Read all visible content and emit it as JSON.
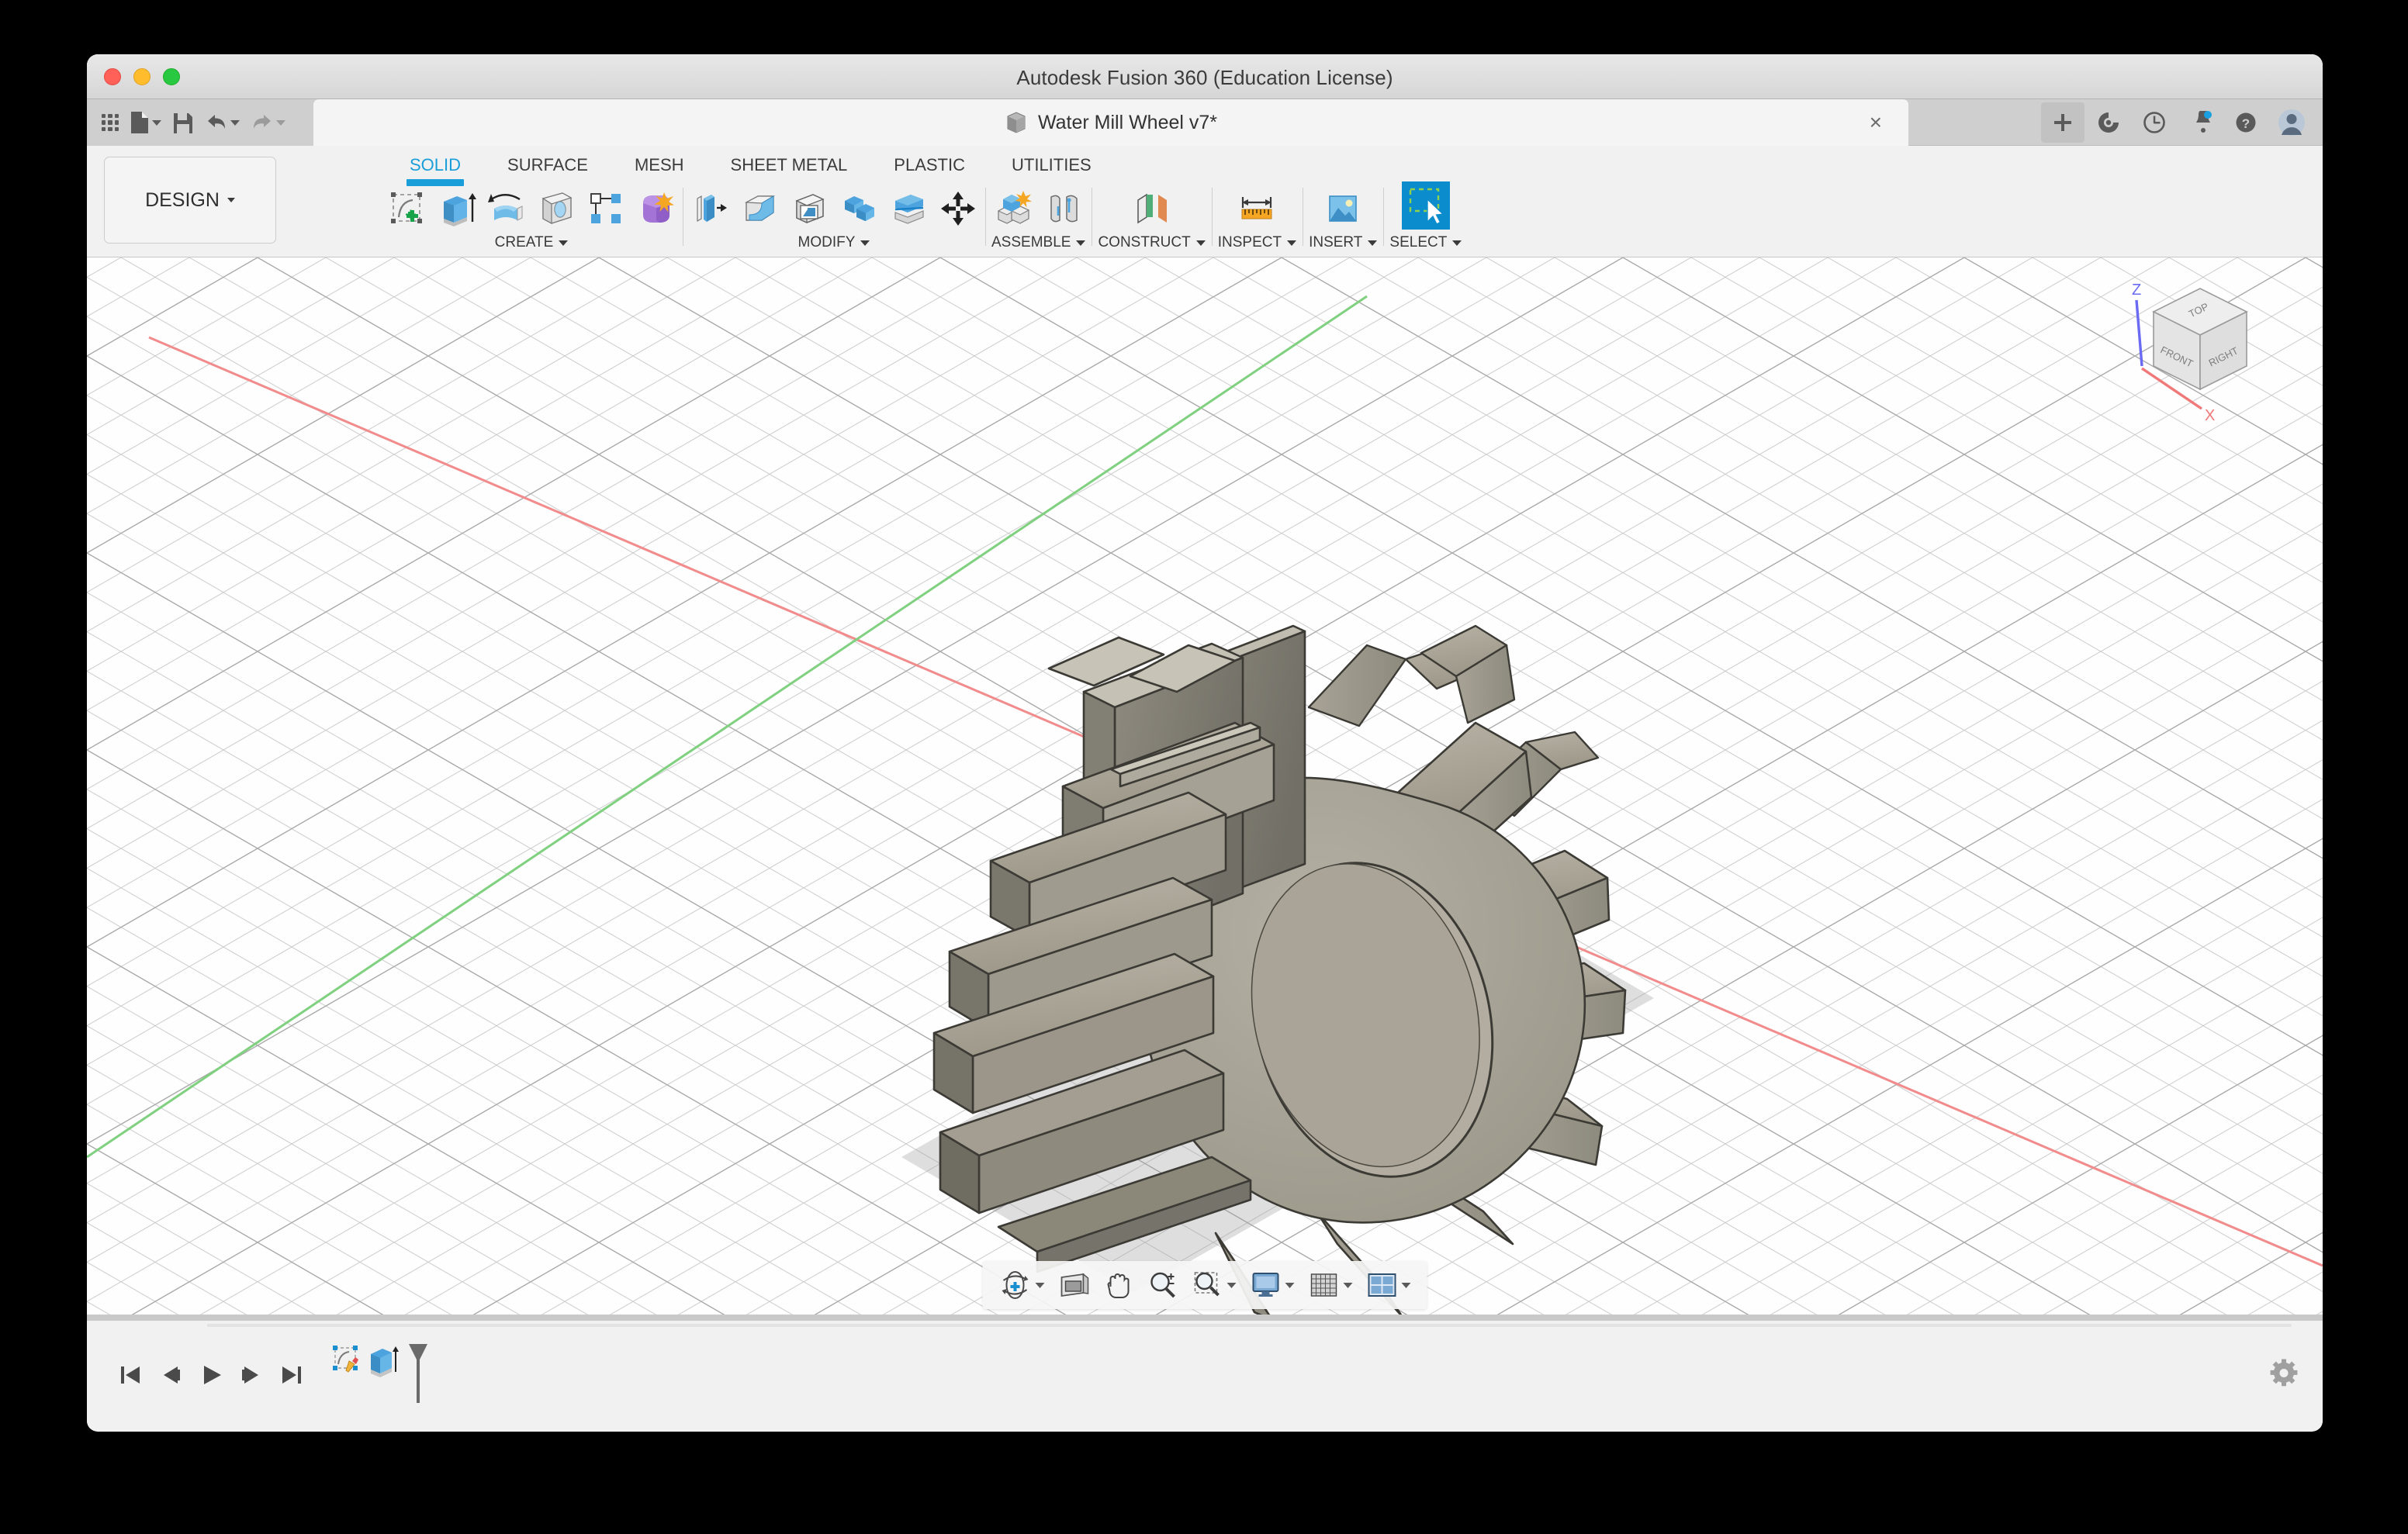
{
  "window": {
    "app_title": "Autodesk Fusion 360 (Education License)",
    "traffic_lights": [
      "close",
      "minimize",
      "maximize"
    ]
  },
  "quick_access": {
    "items": [
      {
        "name": "app-grid-icon",
        "label": "Show Data Panel"
      },
      {
        "name": "new-file-icon",
        "label": "File"
      },
      {
        "name": "save-icon",
        "label": "Save"
      },
      {
        "name": "undo-icon",
        "label": "Undo"
      },
      {
        "name": "redo-icon",
        "label": "Redo"
      }
    ]
  },
  "document_tab": {
    "title": "Water Mill Wheel v7*",
    "close_label": "×",
    "new_tab_label": "+"
  },
  "tab_right_icons": [
    {
      "name": "extensions-icon",
      "label": "Extensions"
    },
    {
      "name": "job-status-clock-icon",
      "label": "Job Status"
    },
    {
      "name": "notifications-bell-icon",
      "label": "Notifications",
      "badge": true
    },
    {
      "name": "help-icon",
      "label": "Help"
    },
    {
      "name": "account-avatar",
      "label": "Account"
    }
  ],
  "ribbon": {
    "design_label": "DESIGN",
    "tabs": [
      {
        "label": "SOLID",
        "active": true
      },
      {
        "label": "SURFACE",
        "active": false
      },
      {
        "label": "MESH",
        "active": false
      },
      {
        "label": "SHEET METAL",
        "active": false
      },
      {
        "label": "PLASTIC",
        "active": false
      },
      {
        "label": "UTILITIES",
        "active": false
      }
    ],
    "panels": [
      {
        "label": "CREATE",
        "tools": [
          "create-sketch-icon",
          "extrude-icon",
          "revolve-icon",
          "hole-icon",
          "pattern-icon",
          "form-icon"
        ]
      },
      {
        "label": "MODIFY",
        "tools": [
          "press-pull-icon",
          "fillet-icon",
          "shell-icon",
          "combine-icon",
          "split-face-icon",
          "move-copy-icon"
        ]
      },
      {
        "label": "ASSEMBLE",
        "tools": [
          "new-component-icon",
          "joint-icon"
        ]
      },
      {
        "label": "CONSTRUCT",
        "tools": [
          "offset-plane-icon"
        ]
      },
      {
        "label": "INSPECT",
        "tools": [
          "measure-icon"
        ]
      },
      {
        "label": "INSERT",
        "tools": [
          "insert-canvas-icon"
        ]
      },
      {
        "label": "SELECT",
        "tools": [
          "select-window-icon"
        ]
      }
    ]
  },
  "viewcube": {
    "faces": {
      "top": "TOP",
      "front": "FRONT",
      "right": "RIGHT"
    },
    "axes": {
      "z": "Z",
      "x": "X"
    },
    "colors": {
      "z_axis": "#5a5af0",
      "x_axis": "#f06060"
    }
  },
  "canvas": {
    "background": "#fefefe",
    "grid_color": "#cfcfcf",
    "x_axis_color": "#f28b8b",
    "y_axis_color": "#7fd07f",
    "model_name": "water-mill-wheel",
    "model_fill": "#9a968b",
    "ground_shadow": "#d6d6d6"
  },
  "navbar": {
    "items": [
      {
        "name": "orbit-icon",
        "label": "Orbit",
        "has_caret": true
      },
      {
        "name": "look-at-icon",
        "label": "Look At",
        "has_caret": false
      },
      {
        "name": "pan-icon",
        "label": "Pan",
        "has_caret": false
      },
      {
        "name": "zoom-icon",
        "label": "Zoom",
        "has_caret": false
      },
      {
        "name": "fit-icon",
        "label": "Fit",
        "has_caret": true
      },
      {
        "name": "display-settings-icon",
        "label": "Display Settings",
        "has_caret": true
      },
      {
        "name": "grid-snaps-icon",
        "label": "Grid and Snaps",
        "has_caret": true
      },
      {
        "name": "viewports-icon",
        "label": "Viewports",
        "has_caret": true
      }
    ]
  },
  "timeline": {
    "controls": [
      {
        "name": "go-to-beginning-button",
        "label": "Go to beginning"
      },
      {
        "name": "step-back-button",
        "label": "Step back"
      },
      {
        "name": "play-button",
        "label": "Play"
      },
      {
        "name": "step-forward-button",
        "label": "Step forward"
      },
      {
        "name": "go-to-end-button",
        "label": "Go to end"
      }
    ],
    "features": [
      {
        "name": "timeline-feature-sketch",
        "label": "Sketch"
      },
      {
        "name": "timeline-feature-extrude",
        "label": "Extrude"
      }
    ],
    "settings_label": "Timeline Settings"
  }
}
